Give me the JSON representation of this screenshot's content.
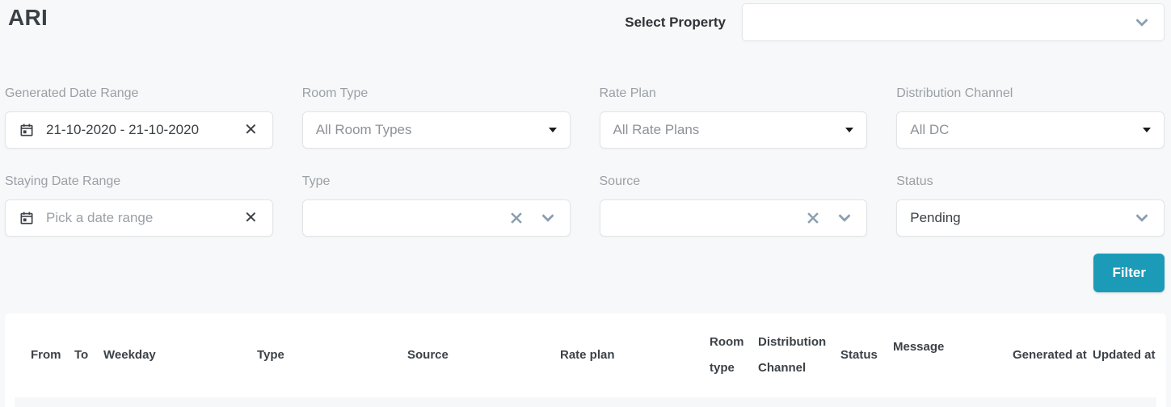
{
  "page": {
    "title": "ARI"
  },
  "property_selector": {
    "label": "Select Property",
    "value": ""
  },
  "filters": {
    "generated_date_range": {
      "label": "Generated Date Range",
      "value": "21-10-2020 - 21-10-2020"
    },
    "room_type": {
      "label": "Room Type",
      "value": "All Room Types"
    },
    "rate_plan": {
      "label": "Rate Plan",
      "value": "All Rate Plans"
    },
    "distribution_channel": {
      "label": "Distribution Channel",
      "value": "All DC"
    },
    "staying_date_range": {
      "label": "Staying Date Range",
      "placeholder": "Pick a date range",
      "value": ""
    },
    "type": {
      "label": "Type",
      "value": ""
    },
    "source": {
      "label": "Source",
      "value": ""
    },
    "status": {
      "label": "Status",
      "value": "Pending"
    }
  },
  "actions": {
    "filter_button": "Filter"
  },
  "table": {
    "columns": [
      "From",
      "To",
      "Weekday",
      "Type",
      "Source",
      "Rate plan",
      "Room type",
      "Distribution Channel",
      "Status",
      "Message",
      "Generated at",
      "Updated at"
    ],
    "rows": []
  },
  "colors": {
    "accent": "#1b9bb8",
    "label_gray": "#9aa0a6"
  }
}
